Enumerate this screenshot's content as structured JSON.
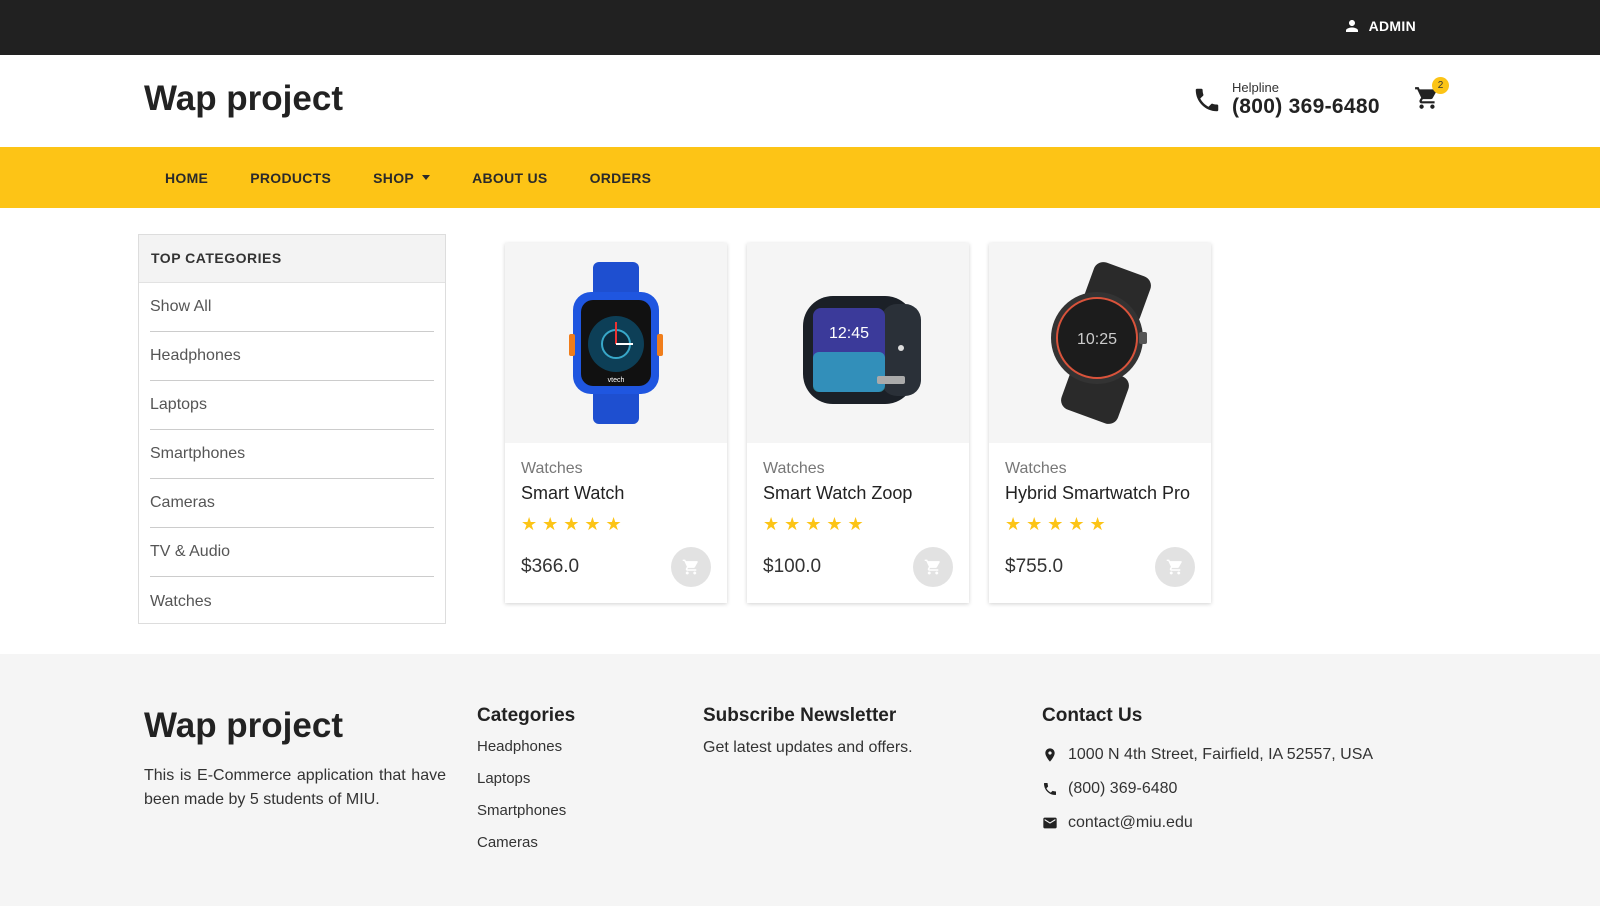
{
  "topbar": {
    "admin_label": "ADMIN",
    "admin_icon": "person-icon"
  },
  "header": {
    "logo": "Wap project",
    "helpline_label": "Helpline",
    "helpline_number": "(800) 369-6480",
    "cart_count": "2"
  },
  "nav": {
    "items": [
      "HOME",
      "PRODUCTS",
      "SHOP",
      "ABOUT US",
      "ORDERS"
    ]
  },
  "sidebar": {
    "title": "TOP CATEGORIES",
    "items": [
      "Show All",
      "Headphones",
      "Laptops",
      "Smartphones",
      "Cameras",
      "TV & Audio",
      "Watches"
    ]
  },
  "products": [
    {
      "category": "Watches",
      "name": "Smart Watch",
      "rating": 5,
      "stars": "★★★★★",
      "price": "$366.0"
    },
    {
      "category": "Watches",
      "name": "Smart Watch Zoop",
      "rating": 5,
      "stars": "★★★★★",
      "price": "$100.0"
    },
    {
      "category": "Watches",
      "name": "Hybrid Smartwatch Pro",
      "rating": 5,
      "stars": "★★★★★",
      "price": "$755.0"
    }
  ],
  "footer": {
    "logo": "Wap project",
    "about": "This is E-Commerce application that have been made by 5 students of MIU.",
    "categories_title": "Categories",
    "categories": [
      "Headphones",
      "Laptops",
      "Smartphones",
      "Cameras"
    ],
    "newsletter_title": "Subscribe Newsletter",
    "newsletter_text": "Get latest updates and offers.",
    "contact_title": "Contact Us",
    "address": "1000 N 4th Street, Fairfield, IA 52557, USA",
    "phone": "(800) 369-6480",
    "email": "contact@miu.edu"
  },
  "colors": {
    "accent": "#fdc416",
    "topbar": "#212121",
    "footer_bg": "#f5f5f5"
  }
}
